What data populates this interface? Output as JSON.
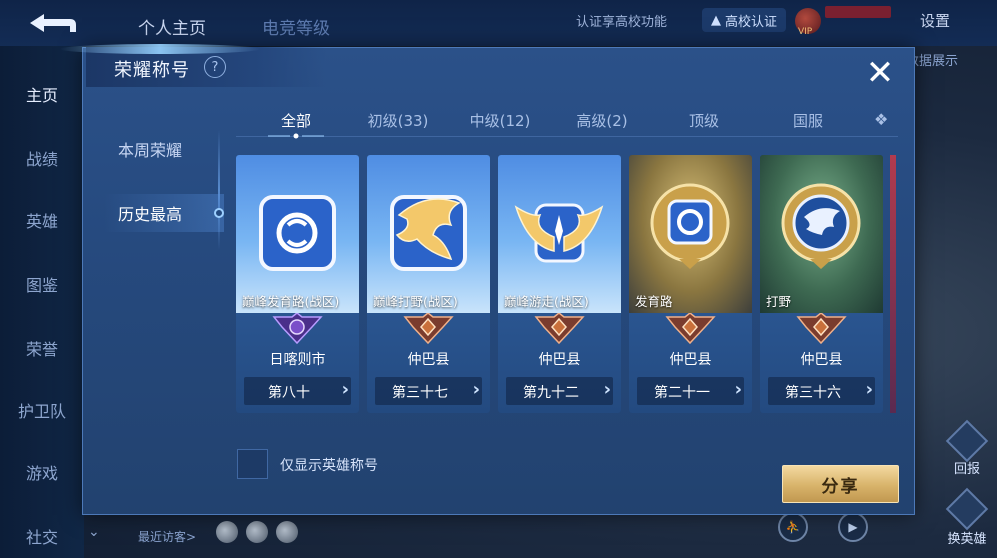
{
  "header": {
    "tabs": [
      "个人主页",
      "电竞等级"
    ],
    "verify_note": "认证享高校功能",
    "campus_badge": "高校认证",
    "vip_label": "VIP",
    "settings_label": "设置",
    "showcase_label": "数据展示"
  },
  "sidebar": {
    "items": [
      "主页",
      "战绩",
      "英雄",
      "图鉴",
      "荣誉",
      "护卫队",
      "游戏",
      "社交"
    ]
  },
  "footer": {
    "recent_visitors_label": "最近访客>"
  },
  "right_side": {
    "top_button": "回报",
    "bottom_button": "换英雄"
  },
  "dialog": {
    "title": "荣耀称号",
    "help_icon": "?",
    "close_icon": "✕",
    "filters": [
      "本周荣耀",
      "历史最高"
    ],
    "active_filter_index": 1,
    "tabs": [
      "全部",
      "初级(33)",
      "中级(12)",
      "高级(2)",
      "顶级",
      "国服"
    ],
    "active_tab_index": 0,
    "cards": [
      {
        "name": "巅峰发育路(战区)",
        "region": "日喀则市",
        "rank": "第八十",
        "style": "peak",
        "emblem": "purple"
      },
      {
        "name": "巅峰打野(战区)",
        "region": "仲巴县",
        "rank": "第三十七",
        "style": "peak",
        "emblem": "bronze"
      },
      {
        "name": "巅峰游走(战区)",
        "region": "仲巴县",
        "rank": "第九十二",
        "style": "peak",
        "emblem": "bronze"
      },
      {
        "name": "发育路",
        "region": "仲巴县",
        "rank": "第二十一",
        "style": "gold",
        "emblem": "bronze"
      },
      {
        "name": "打野",
        "region": "仲巴县",
        "rank": "第三十六",
        "style": "teal",
        "emblem": "bronze"
      }
    ],
    "card_arrow": "›",
    "checkbox_label": "仅显示英雄称号",
    "share_button": "分享"
  },
  "colors": {
    "dialog_bg": "#264a7f",
    "share_gold": "#d8b36a",
    "emblem_purple": "#7a4fc9",
    "emblem_bronze": "#c9703b"
  }
}
